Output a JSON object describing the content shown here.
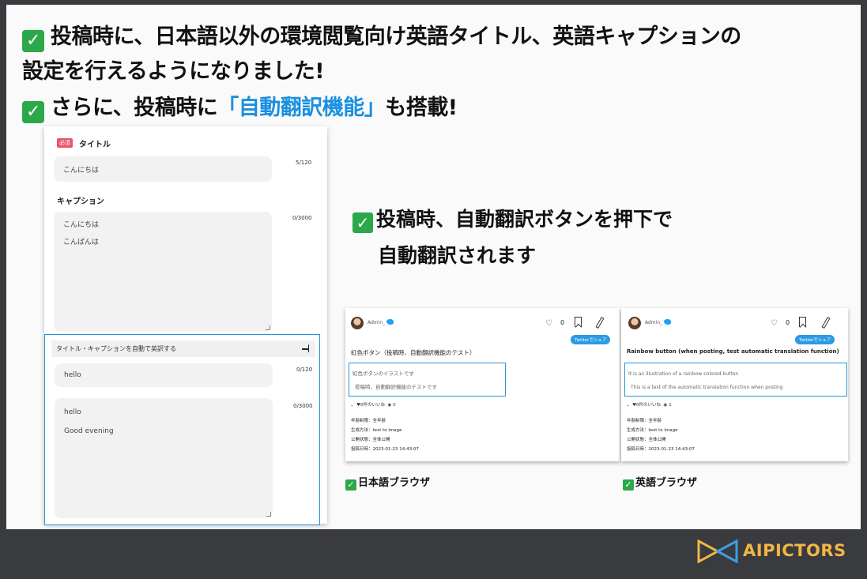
{
  "headline": {
    "line1": "投稿時に、日本語以外の環境閲覧向け英語タイトル、英語キャプションの",
    "line2": "設定を行えるようになりました!",
    "line3_pre": "さらに、投稿時に",
    "line3_highlight": "「自動翻訳機能」",
    "line3_post": "も搭載!",
    "check_glyph": "✓"
  },
  "form": {
    "required_badge": "必須",
    "title_label": "タイトル",
    "title_value": "こんにちは",
    "title_count": "5/120",
    "caption_label": "キャプション",
    "caption_line1": "こんにちは",
    "caption_line2": "こんばんは",
    "caption_count": "0/3000",
    "translate_bar": "タイトル・キャプションを自動で英訳する",
    "en_title_value": "hello",
    "en_title_count": "0/120",
    "en_caption_line1": "hello",
    "en_caption_line2": "Good evening",
    "en_caption_count": "0/3000"
  },
  "subhead": {
    "line1": "投稿時、自動翻訳ボタンを押下で",
    "line2": "自動翻訳されます"
  },
  "jp_card": {
    "username": "Admin_",
    "likes": "0",
    "share_label": "Twitterでシェア",
    "title": "虹色ボタン（投稿時、自動翻訳機能のテスト）",
    "desc_line1": "虹色ボタンのイラストです",
    "desc_line2": "投稿時、自動翻訳機能のテストです",
    "stats_likes": "0件のいいね",
    "stats_views": "0",
    "meta": [
      "年齢制限：全年齢",
      "生成方法：text to image",
      "公開状態：全体公開",
      "投稿日時：2023-01-23 14:43:07"
    ]
  },
  "en_card": {
    "username": "Admin_",
    "likes": "0",
    "share_label": "Twitterでシェア",
    "title": "Rainbow button (when posting, test automatic translation function)",
    "desc_line1": "It is an illustration of a rainbow-colored button",
    "desc_line2": "This is a test of the automatic translation function when posting",
    "stats_likes": "0件のいいね",
    "stats_views": "1",
    "meta": [
      "年齢制限：全年齢",
      "生成方法：text to image",
      "公開状態：全体公開",
      "投稿日時：2023-01-23 14:43:07"
    ]
  },
  "captions": {
    "jp": "日本語ブラウザ",
    "en": "英語ブラウザ"
  },
  "logo": {
    "text": "AIPICTORS"
  },
  "colors": {
    "accent_blue": "#1a8fe0",
    "check_green": "#2ba84a",
    "logo_gold": "#f2b645",
    "frame": "#3a3b3f"
  }
}
